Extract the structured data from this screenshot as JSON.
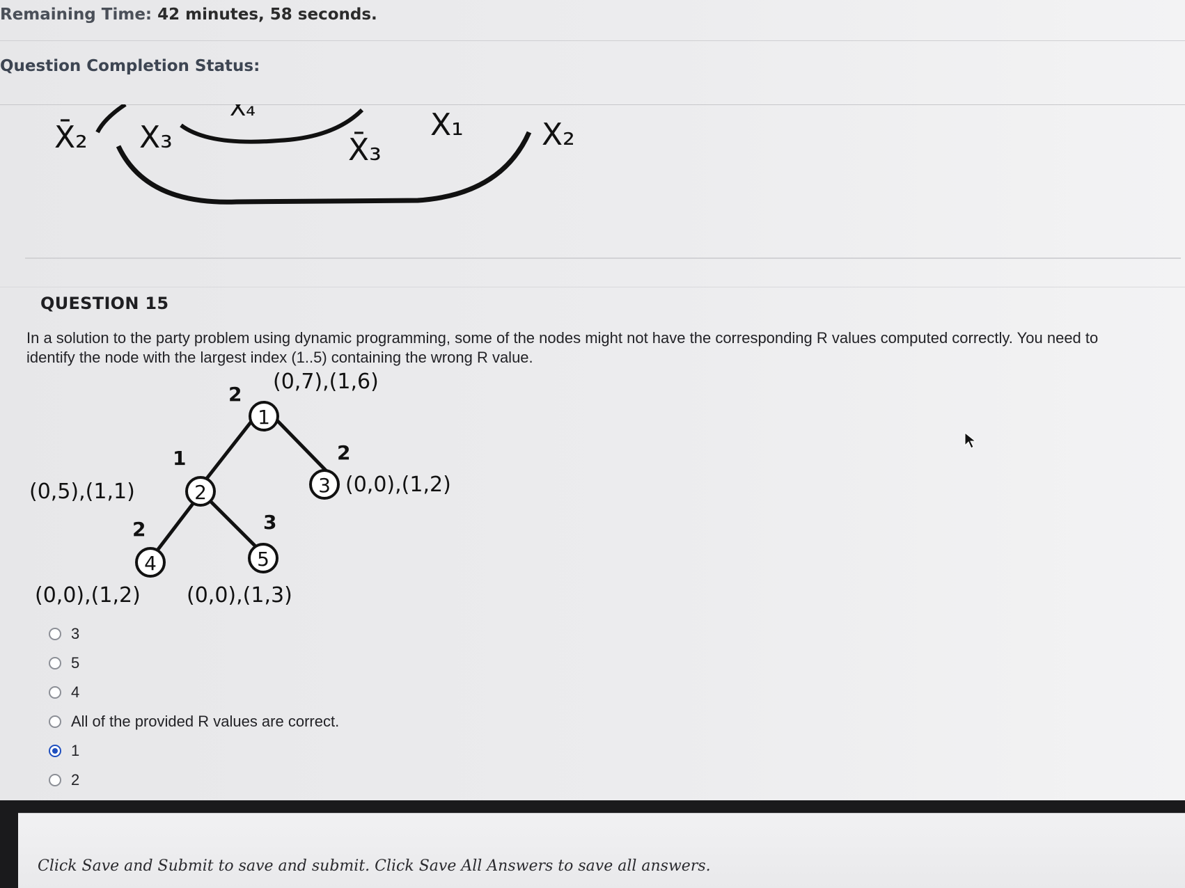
{
  "timer": {
    "label": "Remaining Time:",
    "value": "42 minutes, 58 seconds."
  },
  "completion": {
    "label": "Question Completion Status:"
  },
  "previous_figure": {
    "labels": [
      "X̄₂",
      "X₃",
      "X₄",
      "X̄₃",
      "X₁",
      "X₂"
    ]
  },
  "question": {
    "number": "QUESTION 15",
    "text": "In a solution to the party problem using dynamic programming, some of the nodes might not have the corresponding R values computed correctly. You need to identify the node with the largest index (1..5) containing the wrong R value."
  },
  "tree": {
    "nodes": [
      {
        "id": "1",
        "weight": "2",
        "r": "(0,7),(1,6)"
      },
      {
        "id": "2",
        "weight": "1",
        "r": "(0,5),(1,1)"
      },
      {
        "id": "3",
        "weight": "2",
        "r": "(0,0),(1,2)"
      },
      {
        "id": "4",
        "weight": "2",
        "r": "(0,0),(1,2)"
      },
      {
        "id": "5",
        "weight": "3",
        "r": "(0,0),(1,3)"
      }
    ]
  },
  "options": [
    {
      "label": "3",
      "selected": false
    },
    {
      "label": "5",
      "selected": false
    },
    {
      "label": "4",
      "selected": false
    },
    {
      "label": "All of the provided R values are correct.",
      "selected": false
    },
    {
      "label": "1",
      "selected": true
    },
    {
      "label": "2",
      "selected": false
    }
  ],
  "footer": {
    "instruction": "Click Save and Submit to save and submit. Click Save All Answers to save all answers."
  },
  "colors": {
    "accent": "#1f4fbf",
    "text": "#222226",
    "background": "#e9eaec"
  }
}
